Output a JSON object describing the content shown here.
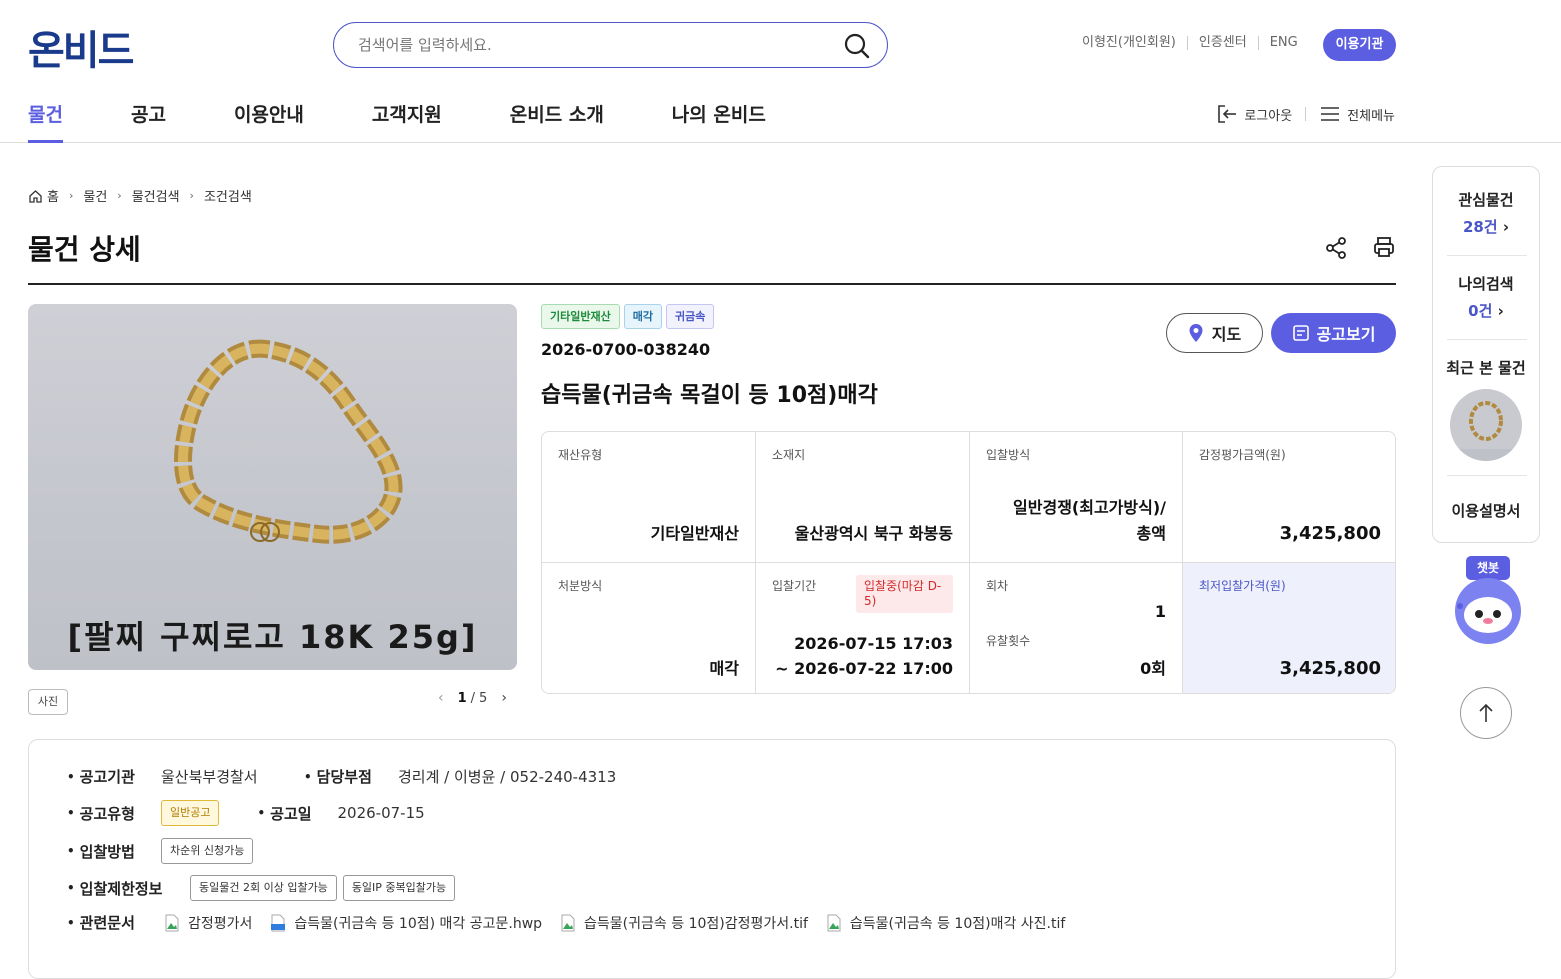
{
  "header": {
    "logo": "온비드",
    "search_placeholder": "검색어를 입력하세요.",
    "toplinks": [
      "이형진(개인회원)",
      "인증센터",
      "ENG"
    ],
    "agency_label": "이용기관",
    "nav": [
      "물건",
      "공고",
      "이용안내",
      "고객지원",
      "온비드 소개",
      "나의 온비드"
    ],
    "logout_label": "로그아웃",
    "allmenu_label": "전체메뉴"
  },
  "breadcrumb": [
    "홈",
    "물건",
    "물건검색",
    "조건검색"
  ],
  "page_title": "물건 상세",
  "photo": {
    "caption": "[팔찌 구찌로고 18K 25g]",
    "tag": "사진",
    "current": "1",
    "total": "5"
  },
  "item": {
    "tags": [
      "기타일반재산",
      "매각",
      "귀금속"
    ],
    "number": "2026-0700-038240",
    "title": "습득물(귀금속 목걸이 등 10점)매각",
    "map_label": "지도",
    "notice_label": "공고보기"
  },
  "info": {
    "asset_type_label": "재산유형",
    "asset_type": "기타일반재산",
    "location_label": "소재지",
    "location": "울산광역시 북구 화봉동",
    "bid_method_label": "입찰방식",
    "bid_method_1": "일반경쟁(최고가방식)/",
    "bid_method_2": "총액",
    "appraisal_label": "감정평가금액(원)",
    "appraisal": "3,425,800",
    "disposal_label": "처분방식",
    "disposal": "매각",
    "period_label": "입찰기간",
    "status": "입찰중(마감 D-5)",
    "period_start": "2026-07-15 17:03",
    "period_end": "~ 2026-07-22 17:00",
    "round_label": "회차",
    "round": "1",
    "fail_label": "유찰횟수",
    "fail": "0회",
    "min_price_label": "최저입찰가격(원)",
    "min_price": "3,425,800"
  },
  "detail": {
    "agency_key": "공고기관",
    "agency_val": "울산북부경찰서",
    "dept_key": "담당부점",
    "dept_val": "경리계 / 이병윤 / 052-240-4313",
    "type_key": "공고유형",
    "type_chip": "일반공고",
    "date_key": "공고일",
    "date_val": "2026-07-15",
    "bidway_key": "입찰방법",
    "bidway_chip": "차순위 신청가능",
    "limit_key": "입찰제한정보",
    "limit_chips": [
      "동일물건 2회 이상 입찰가능",
      "동일IP 중복입찰가능"
    ],
    "docs_key": "관련문서",
    "docs": [
      "감정평가서",
      "습득물(귀금속 등 10점) 매각 공고문.hwp",
      "습득물(귀금속 등 10점)감정평가서.tif",
      "습득물(귀금속 등 10점)매각 사진.tif"
    ]
  },
  "quick": {
    "fav_label": "관심물건",
    "fav_count": "28건",
    "mysearch_label": "나의검색",
    "mysearch_count": "0건",
    "recent_label": "최근 본 물건",
    "guide_label": "이용설명서",
    "chatbot_label": "챗봇"
  },
  "colors": {
    "accent": "#5b5ee0",
    "brand": "#1a3a8c",
    "danger": "#d42a2a"
  }
}
